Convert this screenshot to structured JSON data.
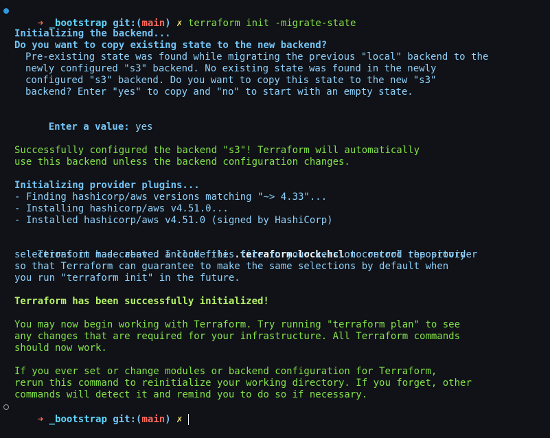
{
  "prompt": {
    "arrow": "➜",
    "directory": "_bootstrap",
    "git_label": "git:",
    "branch_open": "(",
    "branch": "main",
    "branch_close": ")",
    "dirty_mark": "✗",
    "command": "terraform init -migrate-state"
  },
  "backend": {
    "heading1": "Initializing the backend...",
    "heading2": "Do you want to copy existing state to the new backend?",
    "body": [
      "Pre-existing state was found while migrating the previous \"local\" backend to the",
      "newly configured \"s3\" backend. No existing state was found in the newly",
      "configured \"s3\" backend. Do you want to copy this state to the new \"s3\"",
      "backend? Enter \"yes\" to copy and \"no\" to start with an empty state."
    ],
    "enter_label": "Enter a value:",
    "enter_value": "yes",
    "success": [
      "Successfully configured the backend \"s3\"! Terraform will automatically",
      "use this backend unless the backend configuration changes."
    ]
  },
  "providers": {
    "heading": "Initializing provider plugins...",
    "items": [
      "- Finding hashicorp/aws versions matching \"~> 4.33\"...",
      "- Installing hashicorp/aws v4.51.0...",
      "- Installed hashicorp/aws v4.51.0 (signed by HashiCorp)"
    ]
  },
  "lockfile": {
    "line1_prefix": "Terraform has created a lock file ",
    "filename": ".terraform.lock.hcl",
    "line1_suffix": " to record the provider",
    "lines": [
      "selections it made above. Include this file in your version control repository",
      "so that Terraform can guarantee to make the same selections by default when",
      "you run \"terraform init\" in the future."
    ]
  },
  "result": {
    "success_heading": "Terraform has been successfully initialized!",
    "next_steps": [
      "You may now begin working with Terraform. Try running \"terraform plan\" to see",
      "any changes that are required for your infrastructure. All Terraform commands",
      "should now work."
    ],
    "reinit": [
      "If you ever set or change modules or backend configuration for Terraform,",
      "rerun this command to reinitialize your working directory. If you forget, other",
      "commands will detect it and remind you to do so if necessary."
    ]
  },
  "colors": {
    "background": "#101217",
    "blue_text": "#74c5f6",
    "green_text": "#84e24a",
    "bright_green": "#b7f56a",
    "prompt_arrow": "#ff6b5f",
    "prompt_dir": "#5fd8ff",
    "command": "#84e24a"
  },
  "icons": {
    "status_dot_top": "status-dot-filled",
    "status_dot_bottom": "status-dot-hollow"
  }
}
